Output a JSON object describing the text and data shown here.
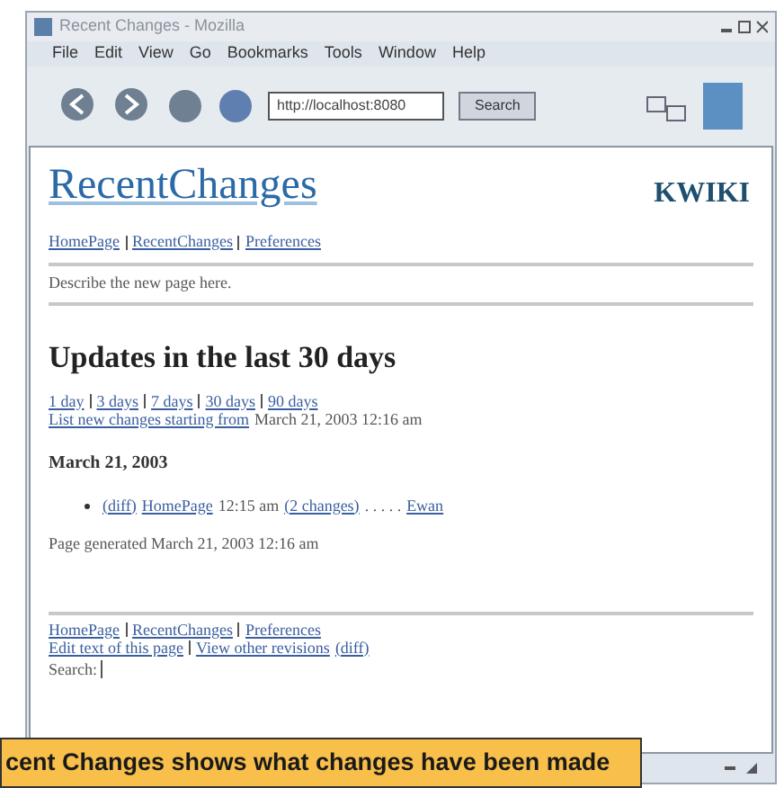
{
  "window": {
    "title": "Recent Changes - Mozilla"
  },
  "menu": [
    "File",
    "Edit",
    "View",
    "Go",
    "Bookmarks",
    "Tools",
    "Window",
    "Help"
  ],
  "toolbar": {
    "address": "http://localhost:8080",
    "search_button": "Search"
  },
  "page": {
    "title": "RecentChanges",
    "logo": "KWIKI",
    "top_links": [
      "HomePage",
      "RecentChanges",
      "Preferences"
    ],
    "description": "Describe the new page here.",
    "heading": "Updates in the last 30 days",
    "day_links": [
      "1 day",
      "3 days",
      "7 days",
      "30 days",
      "90 days"
    ],
    "list_link": "List new changes starting from",
    "list_date": "March 21, 2003 12:16 am",
    "date_heading": "March 21, 2003",
    "entries": [
      {
        "diff": "(diff)",
        "page": "HomePage",
        "time": "12:15 am",
        "changes": "(2 changes)",
        "dots": ". . . . .",
        "author": "Ewan"
      }
    ],
    "generated": "Page generated March 21, 2003 12:16 am",
    "bottom_links": [
      "HomePage",
      "RecentChanges",
      "Preferences"
    ],
    "edit_link": "Edit text of this page",
    "revisions_link": "View other revisions",
    "revisions_diff": "(diff)",
    "search_label": "Search:"
  },
  "caption": "cent Changes shows what changes have been made"
}
